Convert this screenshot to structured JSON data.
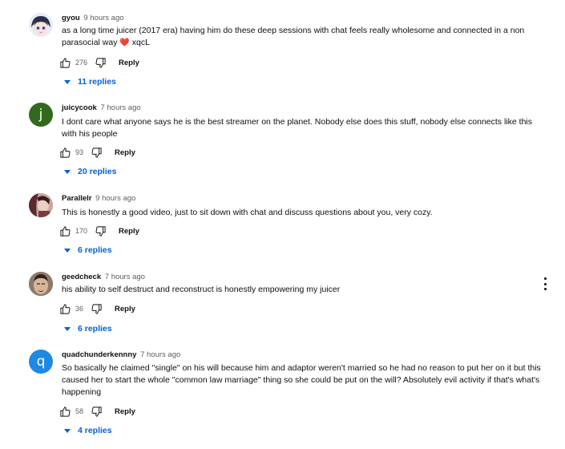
{
  "comments": [
    {
      "author": "gyou",
      "time": "9 hours ago",
      "text": "as a long time juicer (2017 era) having him do these deep sessions with chat feels really wholesome and connected in a non parasocial way",
      "text_suffix": "xqcL",
      "heart": "❤️",
      "likes": "276",
      "reply_label": "Reply",
      "replies": "11 replies",
      "avatar_icon": "anime-avatar-icon"
    },
    {
      "author": "juicycook",
      "time": "7 hours ago",
      "text": "I dont care what anyone says he is the best streamer on the planet. Nobody else does this stuff, nobody else connects like this with his people",
      "likes": "93",
      "reply_label": "Reply",
      "replies": "20 replies",
      "avatar_letter": "j",
      "avatar_color": "#33691e"
    },
    {
      "author": "Parallelr",
      "time": "9 hours ago",
      "text": "This is honestly a good video, just to sit down with chat and discuss questions about you, very cozy.",
      "likes": "170",
      "reply_label": "Reply",
      "replies": "6 replies",
      "avatar_icon": "photo-avatar-icon"
    },
    {
      "author": "geedcheck",
      "time": "7 hours ago",
      "text": "his ability to self destruct and reconstruct is honestly empowering my juicer",
      "likes": "36",
      "reply_label": "Reply",
      "replies": "6 replies",
      "avatar_icon": "face-avatar-icon"
    },
    {
      "author": "quadchunderkennny",
      "time": "7 hours ago",
      "text": "So basically he claimed \"single\" on his will because him and adaptor weren't married so he had no reason to put her on it but this caused her to start the whole \"common law marriage\" thing so she could be put on the will? Absolutely evil activity if that's what's happening",
      "likes": "58",
      "reply_label": "Reply",
      "replies": "4 replies",
      "avatar_letter": "q",
      "avatar_color": "#1e88e5"
    }
  ],
  "icons": {
    "like": "thumb-up-icon",
    "dislike": "thumb-down-icon",
    "more": "more-vert-icon",
    "expand": "caret-down-icon"
  }
}
